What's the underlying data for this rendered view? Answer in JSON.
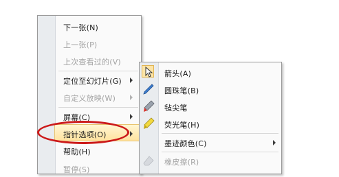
{
  "main_menu": {
    "items": [
      {
        "label": "下一张(N)"
      },
      {
        "label": "上一张(P)"
      },
      {
        "label": "上次查看过的(V)"
      },
      {
        "label": "定位至幻灯片(G)"
      },
      {
        "label": "自定义放映(W)"
      },
      {
        "label": "屏幕(C)"
      },
      {
        "label": "指针选项(O)"
      },
      {
        "label": "帮助(H)"
      },
      {
        "label": "暂停(S)"
      }
    ]
  },
  "pointer_submenu": {
    "items": [
      {
        "label": "箭头(A)",
        "icon": "arrow-pointer-icon"
      },
      {
        "label": "圆珠笔(B)",
        "icon": "ballpoint-pen-icon"
      },
      {
        "label": "毡尖笔",
        "icon": "felt-tip-pen-icon"
      },
      {
        "label": "荧光笔(H)",
        "icon": "highlighter-icon"
      },
      {
        "label": "墨迹颜色(C)"
      },
      {
        "label": "橡皮擦(R)",
        "icon": "eraser-icon"
      }
    ]
  },
  "colors": {
    "highlight_annotation": "#cc1a1a",
    "selected_item_bg": "#ffe3a0"
  }
}
